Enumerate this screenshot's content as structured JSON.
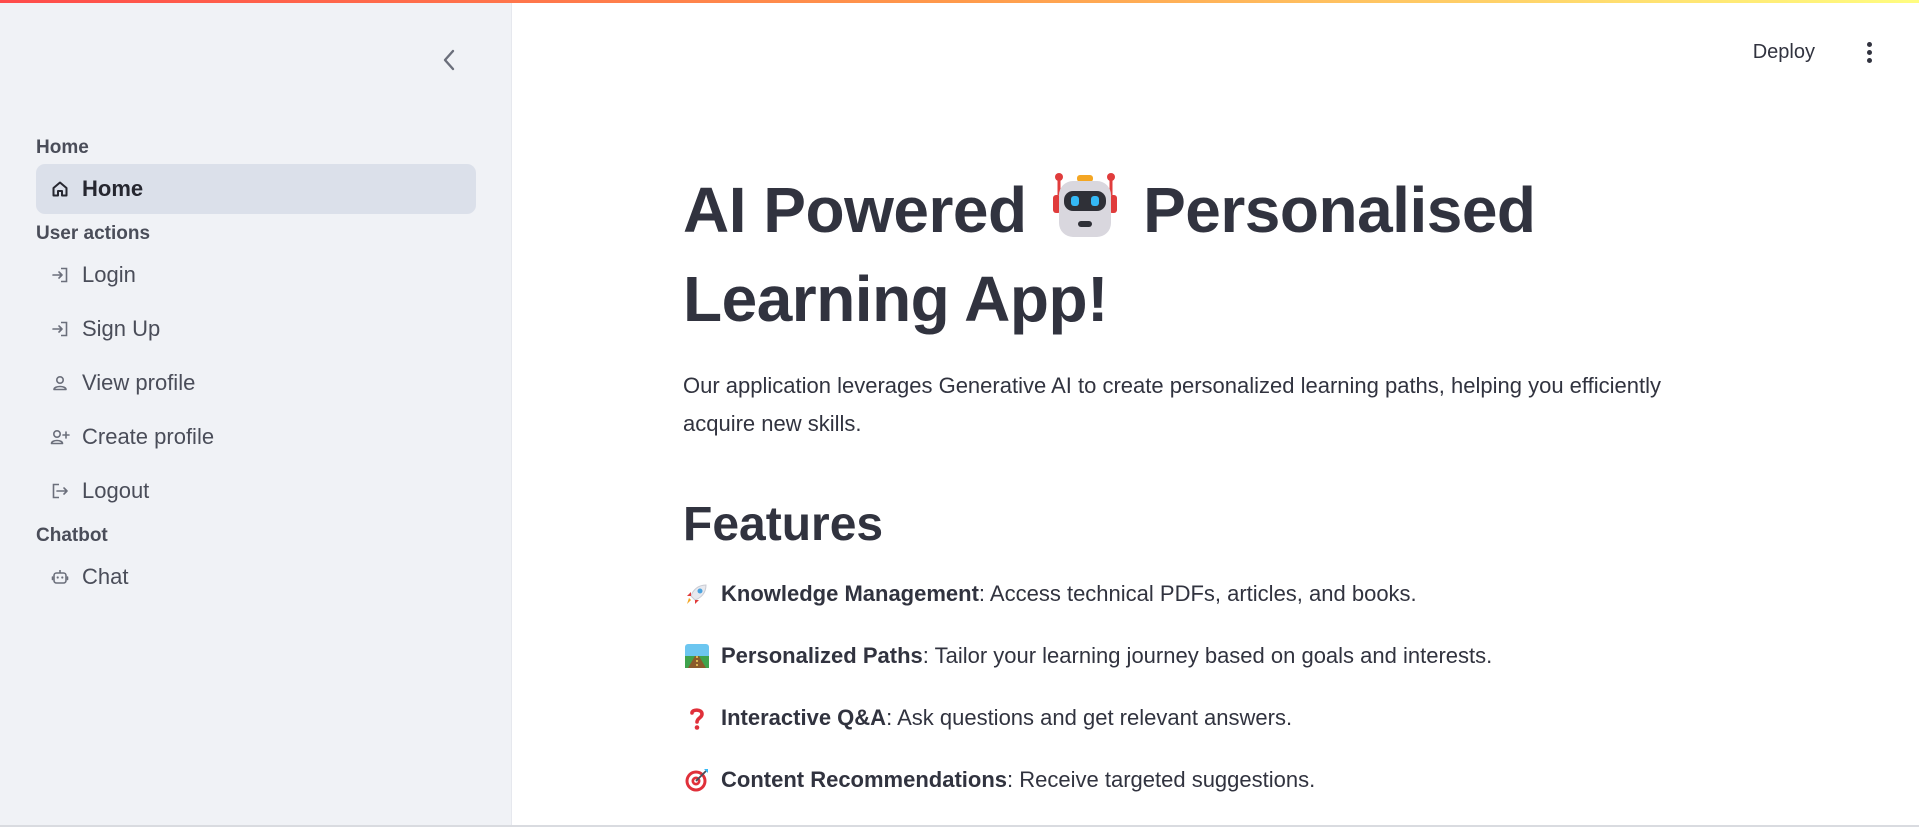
{
  "sidebar": {
    "sections": [
      {
        "title": "Home",
        "items": [
          {
            "label": "Home",
            "icon": "home-icon",
            "active": true
          }
        ]
      },
      {
        "title": "User actions",
        "items": [
          {
            "label": "Login",
            "icon": "login-icon"
          },
          {
            "label": "Sign Up",
            "icon": "login-icon"
          },
          {
            "label": "View profile",
            "icon": "person-icon"
          },
          {
            "label": "Create profile",
            "icon": "person-add-icon"
          },
          {
            "label": "Logout",
            "icon": "logout-icon"
          }
        ]
      },
      {
        "title": "Chatbot",
        "items": [
          {
            "label": "Chat",
            "icon": "robot-icon"
          }
        ]
      }
    ]
  },
  "header": {
    "deploy_label": "Deploy"
  },
  "main": {
    "title_part1": "AI Powered",
    "title_part2": "Personalised Learning App!",
    "intro": "Our application leverages Generative AI to create personalized learning paths, helping you efficiently acquire new skills.",
    "features_heading": "Features",
    "features": [
      {
        "icon": "rocket-icon",
        "name": "Knowledge Management",
        "desc": ": Access technical PDFs, articles, and books."
      },
      {
        "icon": "path-icon",
        "name": "Personalized Paths",
        "desc": ": Tailor your learning journey based on goals and interests."
      },
      {
        "icon": "question-icon",
        "name": "Interactive Q&A",
        "desc": ": Ask questions and get relevant answers."
      },
      {
        "icon": "target-icon",
        "name": "Content Recommendations",
        "desc": ": Receive targeted suggestions."
      }
    ]
  },
  "colors": {
    "sidebar_bg": "#f0f2f6",
    "active_item_bg": "#dbe0ea",
    "text": "#31333f",
    "accent_red": "#ff4b4b"
  }
}
